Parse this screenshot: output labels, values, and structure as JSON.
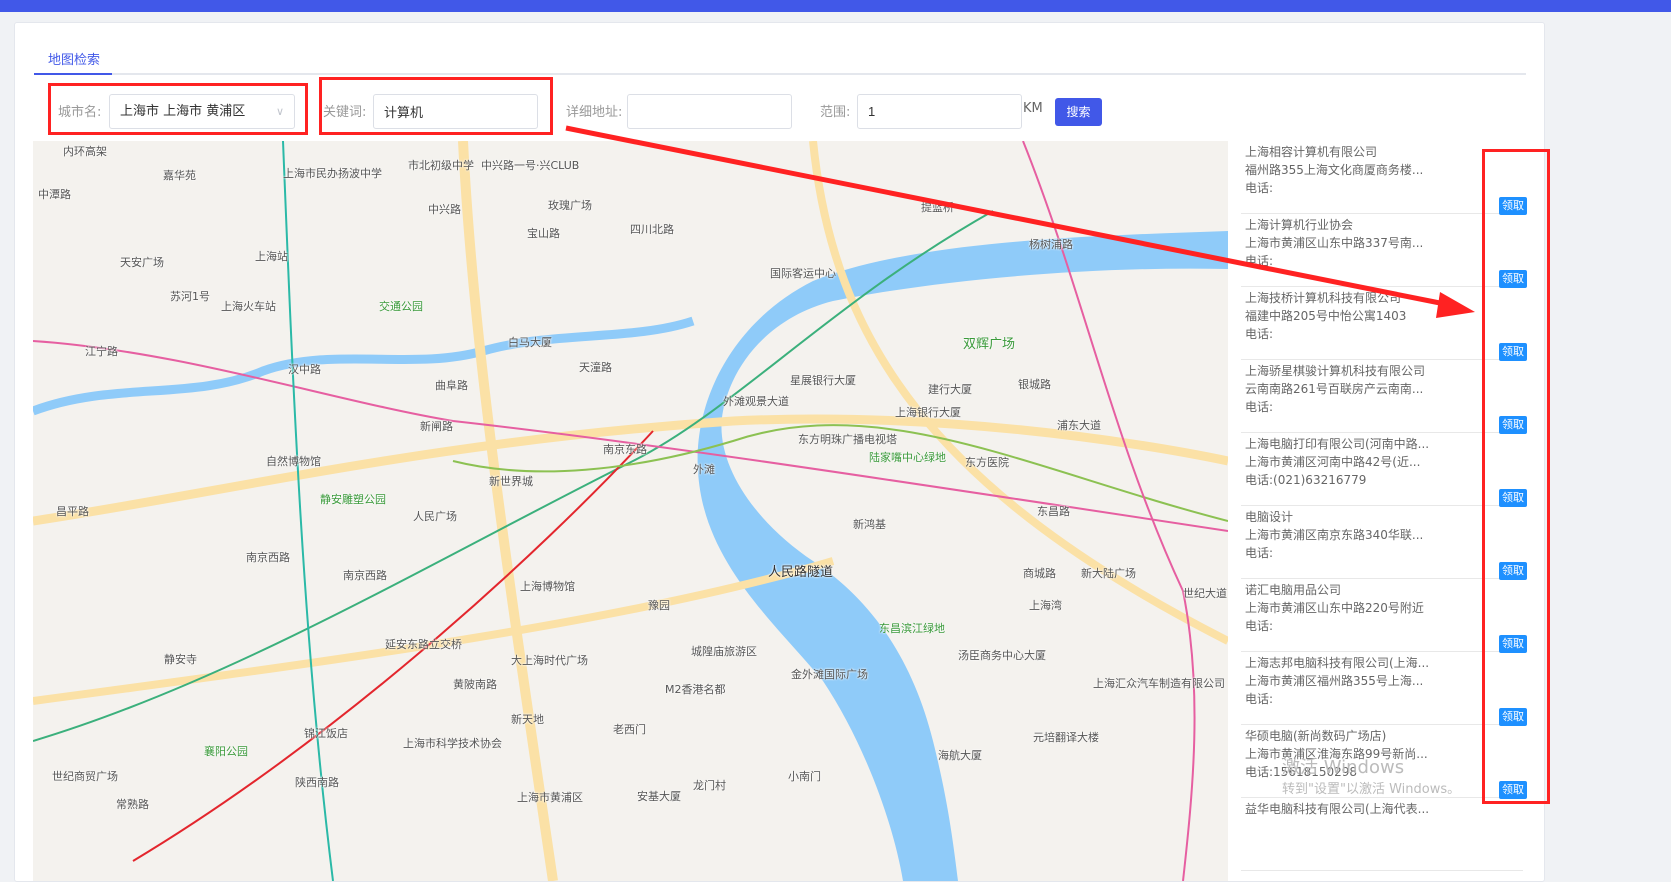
{
  "tab": {
    "label": "地图检索"
  },
  "form": {
    "city_label": "城市名:",
    "city_value": "上海市 上海市 黄浦区",
    "keyword_label": "关键词:",
    "keyword_value": "计算机",
    "address_label": "详细地址:",
    "address_value": "",
    "range_label": "范围:",
    "range_value": "1",
    "range_unit": "KM",
    "search_label": "搜索"
  },
  "map": {
    "labels": [
      "内环高架",
      "中潭路",
      "嘉华苑",
      "上海市民办扬波中学",
      "市北初级中学",
      "中兴路一号·兴CLUB",
      "中兴路",
      "玫瑰广场",
      "宝山路",
      "四川北路",
      "上海站",
      "天安广场",
      "苏河1号",
      "上海火车站",
      "交通公园",
      "国际客运中心",
      "江宁路",
      "汉中路",
      "曲阜路",
      "天潼路",
      "白马大厦",
      "外滩",
      "南京东路",
      "人民广场",
      "新世界城",
      "新闸路",
      "自然博物馆",
      "静安雕塑公园",
      "南京西路",
      "南京西路",
      "豫园",
      "上海博物馆",
      "城隍庙旅游区",
      "人民路隧道",
      "东方明珠广播电视塔",
      "陆家嘴中心绿地",
      "双辉广场",
      "浦东大道",
      "东昌路",
      "商城路",
      "东昌滨江绿地",
      "老西门",
      "黄陂南路",
      "新天地",
      "小南门",
      "陕西南路",
      "常熟路",
      "静安寺",
      "延安东路立交桥",
      "大上海时代广场",
      "杨树浦路",
      "提篮桥",
      "上海银行大厦",
      "东方医院",
      "世纪大道",
      "上海湾",
      "新大陆广场",
      "汤臣商务中心大厦",
      "金外滩国际广场",
      "外滩观景大道",
      "星展银行大厦",
      "建行大厦",
      "银城路",
      "新鸿基",
      "上海市黄浦区",
      "龙门村",
      "安基大厦",
      "M2香港名都",
      "昌平路",
      "世纪商贸广场",
      "襄阳公园",
      "锦江饭店",
      "上海市科学技术协会",
      "海航大厦",
      "元培翻译大楼",
      "上海汇众汽车制造有限公司"
    ]
  },
  "results": [
    {
      "name": "上海相容计算机有限公司",
      "address": "福州路355上海文化商厦商务楼...",
      "phone": "电话:"
    },
    {
      "name": "上海计算机行业协会",
      "address": "上海市黄浦区山东中路337号南...",
      "phone": "电话:"
    },
    {
      "name": "上海技桥计算机科技有限公司",
      "address": "福建中路205号中怡公寓1403",
      "phone": "电话:"
    },
    {
      "name": "上海骄星棋骏计算机科技有限公司",
      "address": "云南南路261号百联房产云南南...",
      "phone": "电话:"
    },
    {
      "name": "上海电脑打印有限公司(河南中路...",
      "address": "上海市黄浦区河南中路42号(近...",
      "phone": "电话:(021)63216779"
    },
    {
      "name": "电脑设计",
      "address": "上海市黄浦区南京东路340华联...",
      "phone": "电话:"
    },
    {
      "name": "诺汇电脑用品公司",
      "address": "上海市黄浦区山东中路220号附近",
      "phone": "电话:"
    },
    {
      "name": "上海志邦电脑科技有限公司(上海...",
      "address": "上海市黄浦区福州路355号上海...",
      "phone": "电话:"
    },
    {
      "name": "华硕电脑(新尚数码广场店)",
      "address": "上海市黄浦区淮海东路99号新尚...",
      "phone": "电话:15618150298"
    },
    {
      "name": "益华电脑科技有限公司(上海代表...",
      "address": "",
      "phone": ""
    }
  ],
  "claim_label": "领取",
  "watermark": {
    "line1": "激活 Windows",
    "line2": "转到\"设置\"以激活 Windows。"
  }
}
